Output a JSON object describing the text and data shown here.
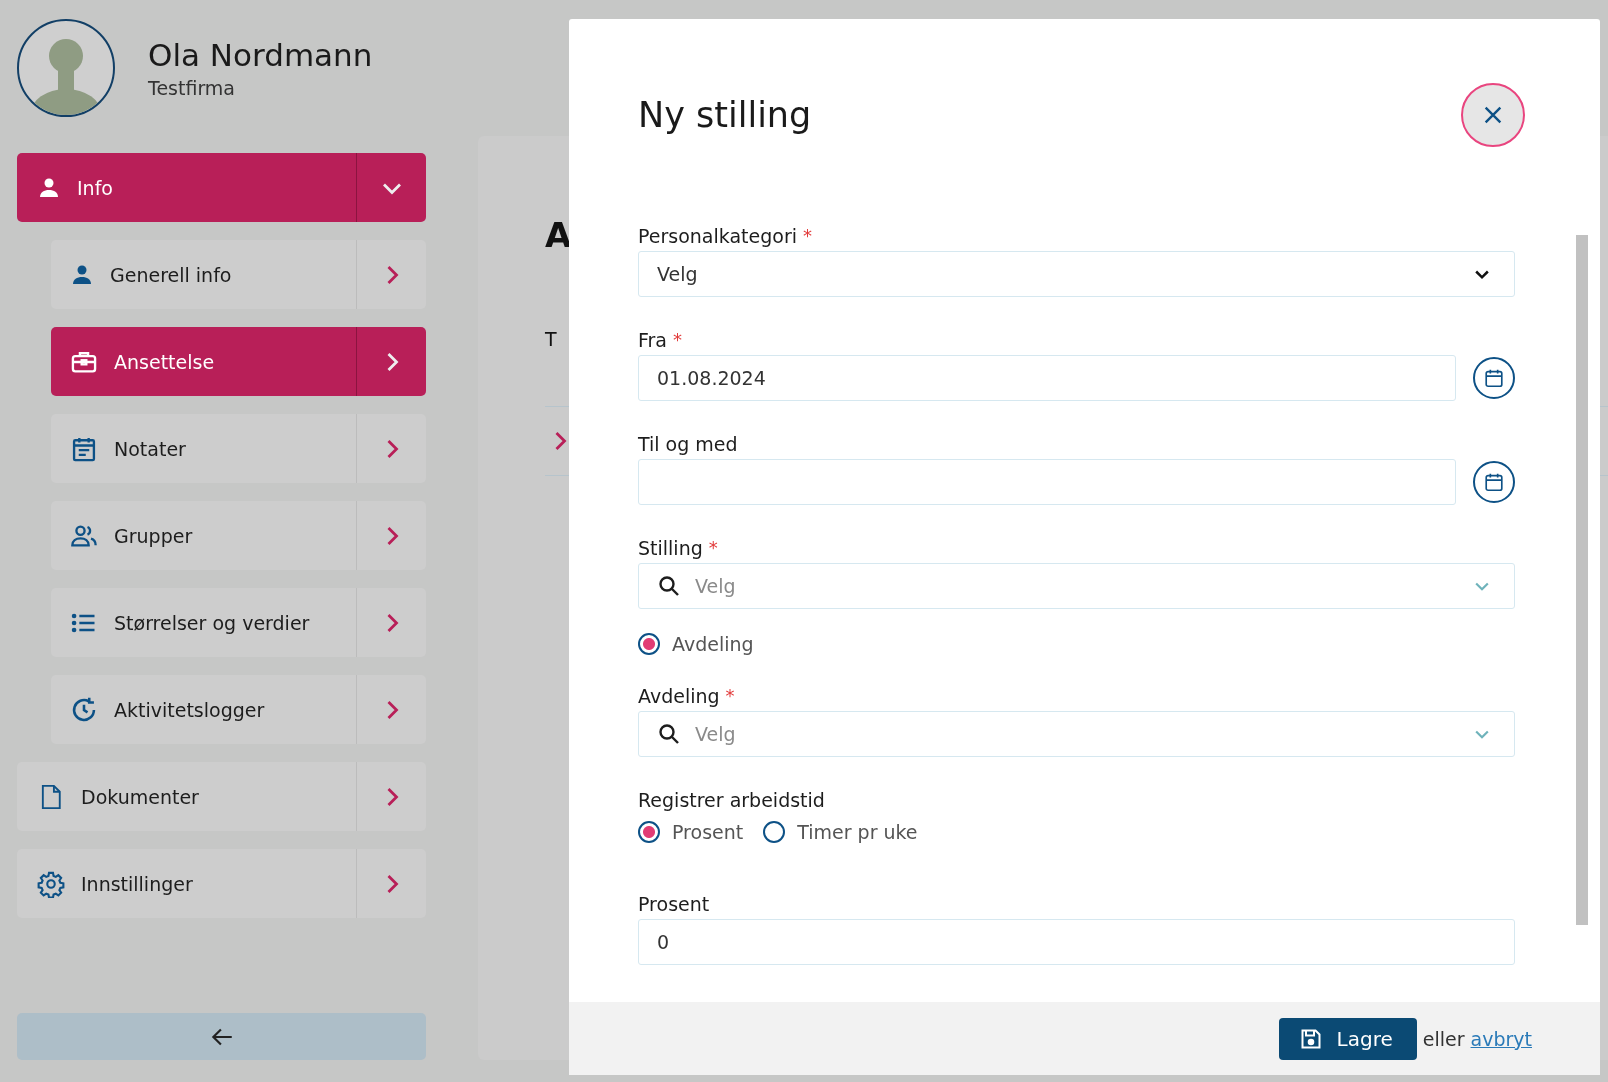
{
  "user": {
    "name": "Ola Nordmann",
    "company": "Testfirma"
  },
  "nav": [
    {
      "label": "Info",
      "selected": true,
      "expanded": true,
      "children": [
        {
          "label": "Generell info",
          "selected": false
        },
        {
          "label": "Ansettelse",
          "selected": true
        },
        {
          "label": "Notater",
          "selected": false
        },
        {
          "label": "Grupper",
          "selected": false
        },
        {
          "label": "Størrelser og verdier",
          "selected": false
        },
        {
          "label": "Aktivitetslogger",
          "selected": false
        }
      ]
    },
    {
      "label": "Dokumenter",
      "selected": false,
      "expanded": false
    },
    {
      "label": "Innstillinger",
      "selected": false,
      "expanded": false
    }
  ],
  "background_page": {
    "heading": "A",
    "text": "T"
  },
  "dialog": {
    "title": "Ny stilling",
    "required_marker": "*",
    "fields": [
      {
        "kind": "select",
        "label": "Personalkategori",
        "required": true,
        "value": "Velg"
      },
      {
        "kind": "date",
        "label": "Fra",
        "required": true,
        "value": "01.08.2024"
      },
      {
        "kind": "date",
        "label": "Til og med",
        "required": false
      },
      {
        "kind": "search",
        "label": "Stilling",
        "required": true,
        "placeholder": "Velg"
      },
      {
        "kind": "radio",
        "options": [
          {
            "label": "Avdeling",
            "selected": true
          }
        ]
      },
      {
        "kind": "search",
        "label": "Avdeling",
        "required": true,
        "placeholder": "Velg"
      },
      {
        "kind": "radio",
        "label": "Registrer arbeidstid",
        "options": [
          {
            "label": "Prosent",
            "selected": true
          },
          {
            "label": "Timer pr uke",
            "selected": false
          }
        ]
      },
      {
        "kind": "text",
        "label": "Prosent",
        "required": false,
        "value": "0"
      }
    ],
    "footer": {
      "save": "Lagre",
      "separator": "eller",
      "cancel": "avbryt"
    }
  }
}
